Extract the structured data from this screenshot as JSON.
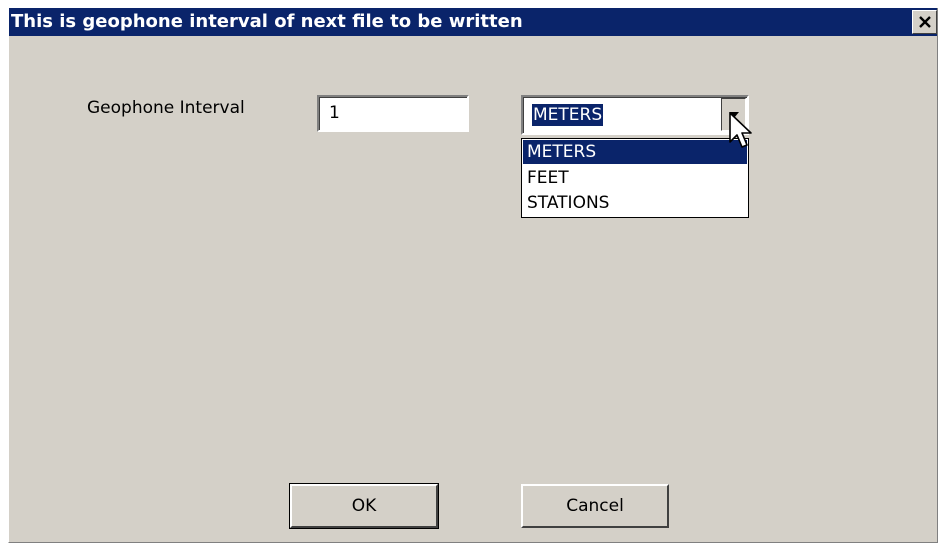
{
  "dialog": {
    "title": "This is geophone interval of next file to be written",
    "close_icon": "close-icon"
  },
  "form": {
    "interval_label": "Geophone Interval",
    "interval_value": "1",
    "units_selected": "METERS",
    "units_options": [
      "METERS",
      "FEET",
      "STATIONS"
    ],
    "units_highlighted_index": 0,
    "dropdown_open": true
  },
  "buttons": {
    "ok_label": "OK",
    "cancel_label": "Cancel"
  },
  "colors": {
    "titlebar": "#0a246a",
    "face": "#d4d0c8",
    "highlight": "#0a246a"
  }
}
